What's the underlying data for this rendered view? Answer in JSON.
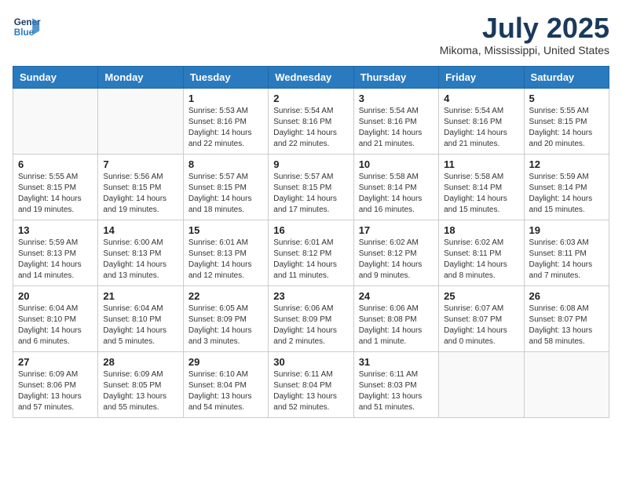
{
  "header": {
    "logo_line1": "General",
    "logo_line2": "Blue",
    "month_year": "July 2025",
    "location": "Mikoma, Mississippi, United States"
  },
  "days_of_week": [
    "Sunday",
    "Monday",
    "Tuesday",
    "Wednesday",
    "Thursday",
    "Friday",
    "Saturday"
  ],
  "weeks": [
    [
      {
        "day": "",
        "info": ""
      },
      {
        "day": "",
        "info": ""
      },
      {
        "day": "1",
        "info": "Sunrise: 5:53 AM\nSunset: 8:16 PM\nDaylight: 14 hours and 22 minutes."
      },
      {
        "day": "2",
        "info": "Sunrise: 5:54 AM\nSunset: 8:16 PM\nDaylight: 14 hours and 22 minutes."
      },
      {
        "day": "3",
        "info": "Sunrise: 5:54 AM\nSunset: 8:16 PM\nDaylight: 14 hours and 21 minutes."
      },
      {
        "day": "4",
        "info": "Sunrise: 5:54 AM\nSunset: 8:16 PM\nDaylight: 14 hours and 21 minutes."
      },
      {
        "day": "5",
        "info": "Sunrise: 5:55 AM\nSunset: 8:15 PM\nDaylight: 14 hours and 20 minutes."
      }
    ],
    [
      {
        "day": "6",
        "info": "Sunrise: 5:55 AM\nSunset: 8:15 PM\nDaylight: 14 hours and 19 minutes."
      },
      {
        "day": "7",
        "info": "Sunrise: 5:56 AM\nSunset: 8:15 PM\nDaylight: 14 hours and 19 minutes."
      },
      {
        "day": "8",
        "info": "Sunrise: 5:57 AM\nSunset: 8:15 PM\nDaylight: 14 hours and 18 minutes."
      },
      {
        "day": "9",
        "info": "Sunrise: 5:57 AM\nSunset: 8:15 PM\nDaylight: 14 hours and 17 minutes."
      },
      {
        "day": "10",
        "info": "Sunrise: 5:58 AM\nSunset: 8:14 PM\nDaylight: 14 hours and 16 minutes."
      },
      {
        "day": "11",
        "info": "Sunrise: 5:58 AM\nSunset: 8:14 PM\nDaylight: 14 hours and 15 minutes."
      },
      {
        "day": "12",
        "info": "Sunrise: 5:59 AM\nSunset: 8:14 PM\nDaylight: 14 hours and 15 minutes."
      }
    ],
    [
      {
        "day": "13",
        "info": "Sunrise: 5:59 AM\nSunset: 8:13 PM\nDaylight: 14 hours and 14 minutes."
      },
      {
        "day": "14",
        "info": "Sunrise: 6:00 AM\nSunset: 8:13 PM\nDaylight: 14 hours and 13 minutes."
      },
      {
        "day": "15",
        "info": "Sunrise: 6:01 AM\nSunset: 8:13 PM\nDaylight: 14 hours and 12 minutes."
      },
      {
        "day": "16",
        "info": "Sunrise: 6:01 AM\nSunset: 8:12 PM\nDaylight: 14 hours and 11 minutes."
      },
      {
        "day": "17",
        "info": "Sunrise: 6:02 AM\nSunset: 8:12 PM\nDaylight: 14 hours and 9 minutes."
      },
      {
        "day": "18",
        "info": "Sunrise: 6:02 AM\nSunset: 8:11 PM\nDaylight: 14 hours and 8 minutes."
      },
      {
        "day": "19",
        "info": "Sunrise: 6:03 AM\nSunset: 8:11 PM\nDaylight: 14 hours and 7 minutes."
      }
    ],
    [
      {
        "day": "20",
        "info": "Sunrise: 6:04 AM\nSunset: 8:10 PM\nDaylight: 14 hours and 6 minutes."
      },
      {
        "day": "21",
        "info": "Sunrise: 6:04 AM\nSunset: 8:10 PM\nDaylight: 14 hours and 5 minutes."
      },
      {
        "day": "22",
        "info": "Sunrise: 6:05 AM\nSunset: 8:09 PM\nDaylight: 14 hours and 3 minutes."
      },
      {
        "day": "23",
        "info": "Sunrise: 6:06 AM\nSunset: 8:09 PM\nDaylight: 14 hours and 2 minutes."
      },
      {
        "day": "24",
        "info": "Sunrise: 6:06 AM\nSunset: 8:08 PM\nDaylight: 14 hours and 1 minute."
      },
      {
        "day": "25",
        "info": "Sunrise: 6:07 AM\nSunset: 8:07 PM\nDaylight: 14 hours and 0 minutes."
      },
      {
        "day": "26",
        "info": "Sunrise: 6:08 AM\nSunset: 8:07 PM\nDaylight: 13 hours and 58 minutes."
      }
    ],
    [
      {
        "day": "27",
        "info": "Sunrise: 6:09 AM\nSunset: 8:06 PM\nDaylight: 13 hours and 57 minutes."
      },
      {
        "day": "28",
        "info": "Sunrise: 6:09 AM\nSunset: 8:05 PM\nDaylight: 13 hours and 55 minutes."
      },
      {
        "day": "29",
        "info": "Sunrise: 6:10 AM\nSunset: 8:04 PM\nDaylight: 13 hours and 54 minutes."
      },
      {
        "day": "30",
        "info": "Sunrise: 6:11 AM\nSunset: 8:04 PM\nDaylight: 13 hours and 52 minutes."
      },
      {
        "day": "31",
        "info": "Sunrise: 6:11 AM\nSunset: 8:03 PM\nDaylight: 13 hours and 51 minutes."
      },
      {
        "day": "",
        "info": ""
      },
      {
        "day": "",
        "info": ""
      }
    ]
  ]
}
